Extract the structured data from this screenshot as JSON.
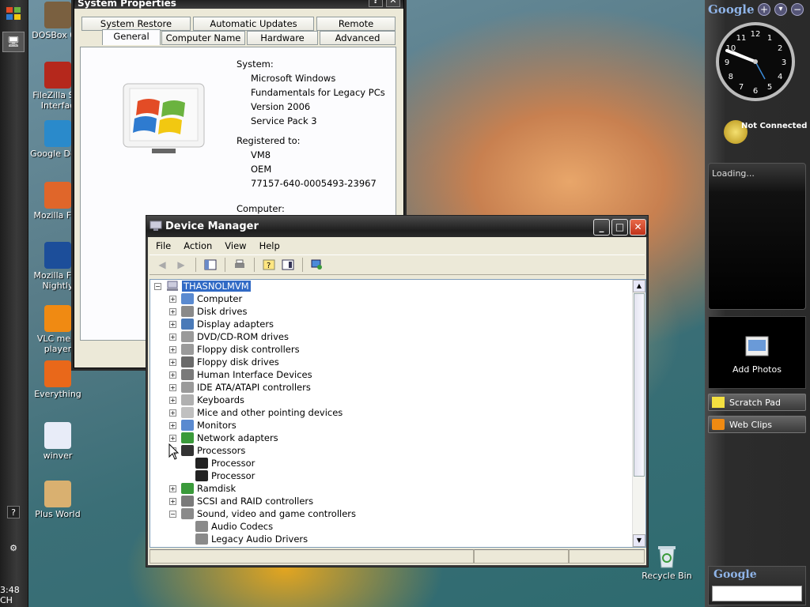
{
  "desktop": {
    "icons": [
      {
        "label": "DOSBox 0.7",
        "color": "#7a6040"
      },
      {
        "label": "FileZilla Ser Interfac",
        "color": "#b5281c"
      },
      {
        "label": "Google Desk",
        "color": "#2a8acb"
      },
      {
        "label": "Mozilla Fire",
        "color": "#e0662a"
      },
      {
        "label": "Mozilla Fire Nightly",
        "color": "#1c4e9a"
      },
      {
        "label": "VLC medi player",
        "color": "#f08a12"
      },
      {
        "label": "Everything",
        "color": "#e9681a"
      },
      {
        "label": "winver",
        "color": "#e8ecf8"
      },
      {
        "label": "Plus World",
        "color": "#d9b070"
      }
    ],
    "recycle_bin": "Recycle Bin",
    "clock_text": "3:48 CH"
  },
  "system_properties": {
    "title": "System Properties",
    "tabs_row1": [
      "System Restore",
      "Automatic Updates",
      "Remote"
    ],
    "tabs_row2": [
      "General",
      "Computer Name",
      "Hardware",
      "Advanced"
    ],
    "system_label": "System:",
    "system_lines": [
      "Microsoft Windows",
      "Fundamentals for Legacy PCs",
      "Version 2006",
      "Service Pack 3"
    ],
    "registered_label": "Registered to:",
    "registered_lines": [
      "VM8",
      "OEM",
      "77157-640-0005493-23967"
    ],
    "partial_label": "Computer:"
  },
  "device_manager": {
    "title": "Device Manager",
    "menu": [
      "File",
      "Action",
      "View",
      "Help"
    ],
    "toolbar_icons": [
      "back-icon",
      "forward-icon",
      "console-tree-icon",
      "print-icon",
      "help-icon",
      "properties-icon",
      "scan-icon"
    ],
    "root": "THASNOLMVM",
    "nodes": [
      {
        "label": "Computer",
        "state": "+",
        "indent": 0,
        "color": "#5a8ad0"
      },
      {
        "label": "Disk drives",
        "state": "+",
        "indent": 0,
        "color": "#8a8a8a"
      },
      {
        "label": "Display adapters",
        "state": "+",
        "indent": 0,
        "color": "#4a7ab8"
      },
      {
        "label": "DVD/CD-ROM drives",
        "state": "+",
        "indent": 0,
        "color": "#9a9a9a"
      },
      {
        "label": "Floppy disk controllers",
        "state": "+",
        "indent": 0,
        "color": "#9a9a9a"
      },
      {
        "label": "Floppy disk drives",
        "state": "+",
        "indent": 0,
        "color": "#6a6a6a"
      },
      {
        "label": "Human Interface Devices",
        "state": "+",
        "indent": 0,
        "color": "#7a7a7a"
      },
      {
        "label": "IDE ATA/ATAPI controllers",
        "state": "+",
        "indent": 0,
        "color": "#9a9a9a"
      },
      {
        "label": "Keyboards",
        "state": "+",
        "indent": 0,
        "color": "#b0b0b0"
      },
      {
        "label": "Mice and other pointing devices",
        "state": "+",
        "indent": 0,
        "color": "#c0c0c0"
      },
      {
        "label": "Monitors",
        "state": "+",
        "indent": 0,
        "color": "#5a8ad0"
      },
      {
        "label": "Network adapters",
        "state": "+",
        "indent": 0,
        "color": "#3a9a3a"
      },
      {
        "label": "Processors",
        "state": "-",
        "indent": 0,
        "color": "#333333"
      },
      {
        "label": "Processor",
        "state": "",
        "indent": 1,
        "color": "#222222"
      },
      {
        "label": "Processor",
        "state": "",
        "indent": 1,
        "color": "#222222"
      },
      {
        "label": "Ramdisk",
        "state": "+",
        "indent": 0,
        "color": "#3a9a3a"
      },
      {
        "label": "SCSI and RAID controllers",
        "state": "+",
        "indent": 0,
        "color": "#7a7a7a"
      },
      {
        "label": "Sound, video and game controllers",
        "state": "-",
        "indent": 0,
        "color": "#8a8a8a"
      },
      {
        "label": "Audio Codecs",
        "state": "",
        "indent": 1,
        "color": "#8a8a8a"
      },
      {
        "label": "Legacy Audio Drivers",
        "state": "",
        "indent": 1,
        "color": "#8a8a8a"
      }
    ]
  },
  "sidebar": {
    "logo": "Google",
    "clock_numbers": [
      "12",
      "1",
      "2",
      "3",
      "4",
      "5",
      "6",
      "7",
      "8",
      "9",
      "10",
      "11"
    ],
    "status": "Not Connected",
    "loading": "Loading...",
    "add_photos": "Add Photos",
    "scratch_pad": "Scratch Pad",
    "web_clips": "Web Clips",
    "search_logo": "Google"
  }
}
